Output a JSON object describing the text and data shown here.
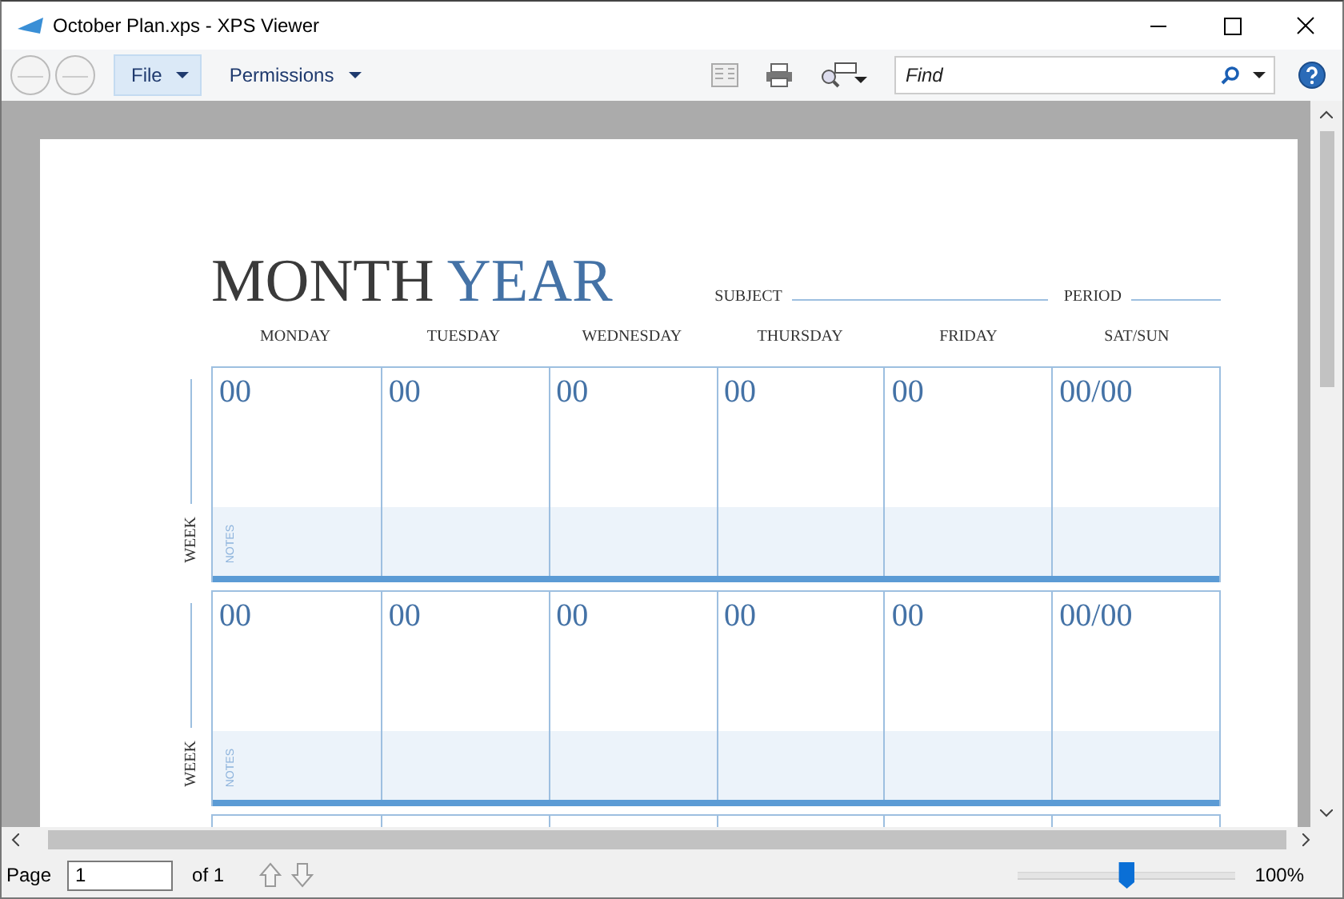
{
  "window": {
    "title": "October Plan.xps - XPS Viewer"
  },
  "menu": [
    {
      "label": "File",
      "selected": true
    },
    {
      "label": "Permissions",
      "selected": false
    }
  ],
  "search": {
    "placeholder": "Find"
  },
  "document": {
    "title_month": "MONTH",
    "title_year": "YEAR",
    "subject_label": "SUBJECT",
    "period_label": "PERIOD",
    "columns": [
      "MONDAY",
      "TUESDAY",
      "WEDNESDAY",
      "THURSDAY",
      "FRIDAY",
      "SAT/SUN"
    ],
    "weeks": [
      {
        "label": "WEEK",
        "notes_label": "NOTES",
        "days": [
          "00",
          "00",
          "00",
          "00",
          "00",
          "00/00"
        ]
      },
      {
        "label": "WEEK",
        "notes_label": "NOTES",
        "days": [
          "00",
          "00",
          "00",
          "00",
          "00",
          "00/00"
        ]
      }
    ]
  },
  "status_bar": {
    "page_label": "Page",
    "page_value": "1",
    "page_total": "of 1",
    "zoom": {
      "level": 0.5
    },
    "zoom_reading": "100%"
  }
}
